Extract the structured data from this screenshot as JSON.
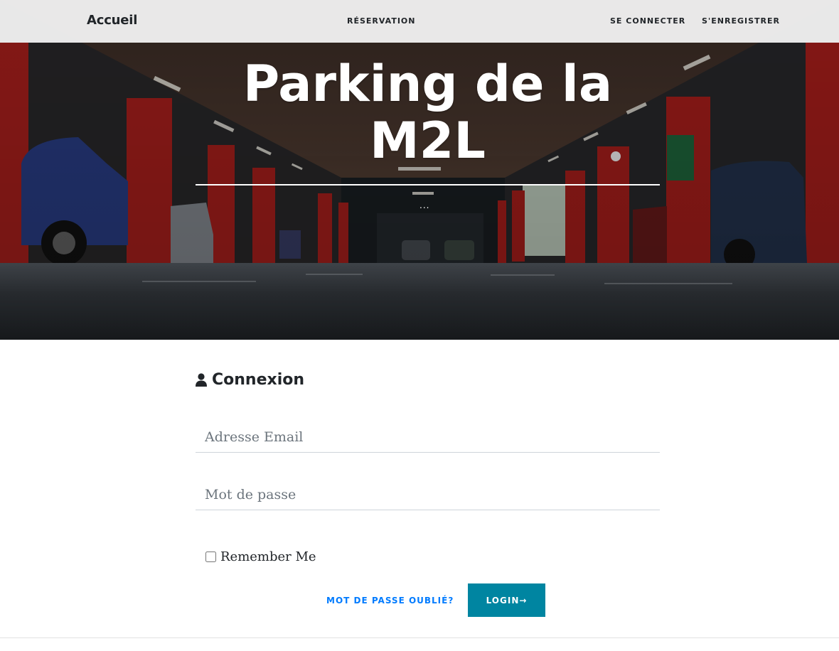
{
  "navbar": {
    "brand": "Accueil",
    "links": [
      "Réservation",
      "Se connecter",
      "S'enregistrer"
    ]
  },
  "hero": {
    "title_line1": "Parking de la",
    "title_line2": "M2L",
    "ornament": "..."
  },
  "login": {
    "heading": "Connexion",
    "email_placeholder": "Adresse Email",
    "password_placeholder": "Mot de passe",
    "remember_label": "Remember Me",
    "forgot_label": "Mot de passe oublié?",
    "submit_label": "Login→"
  },
  "colors": {
    "primary": "#0085a1",
    "link": "#007bff",
    "nav_bg": "#f0f0f0"
  },
  "icons": [
    "user-icon"
  ]
}
